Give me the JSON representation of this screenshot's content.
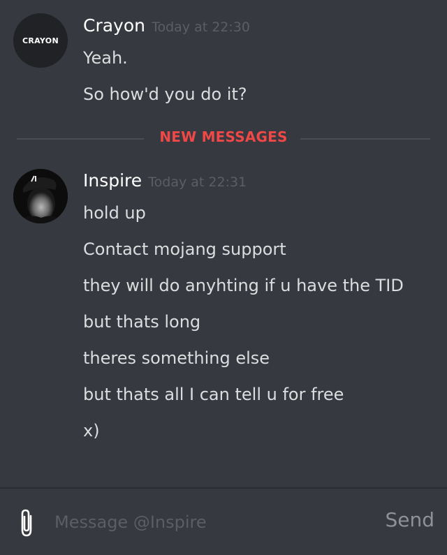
{
  "messages": [
    {
      "author": "Crayon",
      "avatar_text": "CRAYON",
      "timestamp": "Today at 22:30",
      "lines": [
        "Yeah.",
        "So how'd you do it?"
      ]
    },
    {
      "author": "Inspire",
      "timestamp": "Today at 22:31",
      "lines": [
        "hold up",
        "Contact mojang support",
        "they will do anyhting if u have the TID",
        "but thats long",
        "theres something else",
        "but thats all I can tell u for free",
        "x)"
      ]
    }
  ],
  "divider": {
    "label": "NEW MESSAGES",
    "color": "#f04747"
  },
  "composer": {
    "placeholder": "Message @Inspire",
    "value": "",
    "send_label": "Send",
    "attach_icon": "paperclip-icon"
  },
  "colors": {
    "background": "#36393f",
    "username": "#ffffff",
    "timestamp": "#5b5e64",
    "text": "#dcddde"
  }
}
